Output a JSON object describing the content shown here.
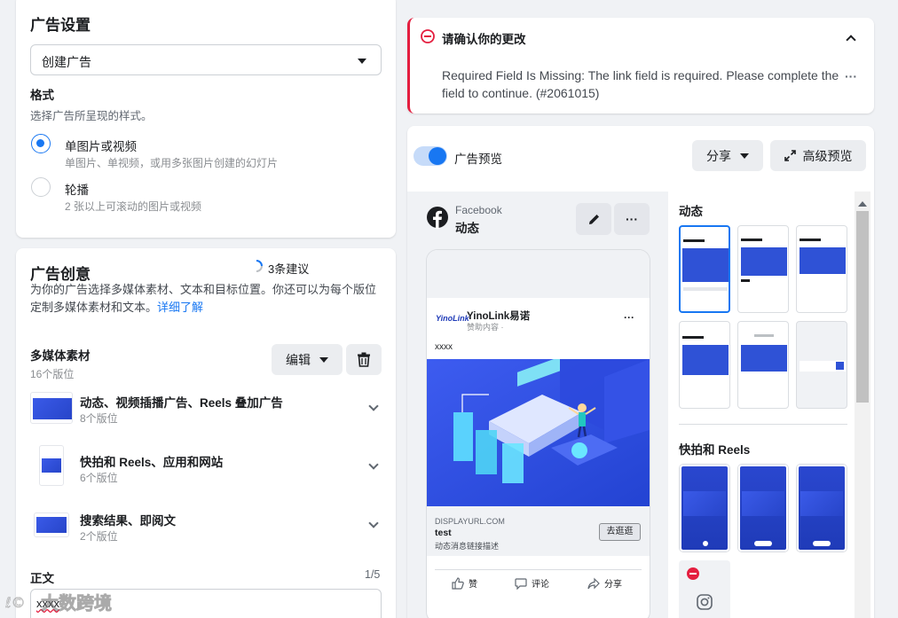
{
  "left": {
    "settings": {
      "title": "广告设置",
      "dropdown_value": "创建广告",
      "format_label": "格式",
      "format_desc": "选择广告所呈现的样式。",
      "options": [
        {
          "label": "单图片或视频",
          "desc": "单图片、单视频，或用多张图片创建的幻灯片",
          "selected": true
        },
        {
          "label": "轮播",
          "desc": "2 张以上可滚动的图片或视频",
          "selected": false
        }
      ]
    },
    "creative": {
      "title": "广告创意",
      "suggestions": "3条建议",
      "desc": "为你的广告选择多媒体素材、文本和目标位置。你还可以为每个版位定制多媒体素材和文本。",
      "learn_more": "详细了解",
      "media_label": "多媒体素材",
      "media_count": "16个版位",
      "edit_button": "编辑",
      "placements": [
        {
          "name": "动态、视频插播广告、Reels 叠加广告",
          "count": "8个版位"
        },
        {
          "name": "快拍和 Reels、应用和网站",
          "count": "6个版位"
        },
        {
          "name": "搜索结果、即阅文",
          "count": "2个版位"
        }
      ],
      "text_label": "正文",
      "text_counter": "1/5",
      "text_value": "xxxx"
    }
  },
  "right": {
    "alert": {
      "title": "请确认你的更改",
      "message": "Required Field Is Missing: The link field is required. Please complete the field to continue. (#2061015)",
      "more": "···"
    },
    "preview": {
      "toggle_label": "广告预览",
      "share_button": "分享",
      "advanced_button": "高级预览",
      "platform": "Facebook",
      "placement": "动态",
      "post": {
        "brand_logo": "YinoLink",
        "page_name": "YinoLink易诺",
        "sponsored": "赞助内容 · ",
        "body_text": "xxxx",
        "display_url": "DISPLAYURL.COM",
        "headline": "test",
        "link_desc": "动态消息链接描述",
        "cta": "去逛逛",
        "actions": [
          "赞",
          "评论",
          "分享"
        ]
      },
      "side_sections": [
        "动态",
        "快拍和 Reels"
      ]
    }
  },
  "watermark": "大数跨境",
  "colors": {
    "accent": "#1877f2",
    "error": "#e41e3f",
    "bg": "#f0f2f5"
  }
}
